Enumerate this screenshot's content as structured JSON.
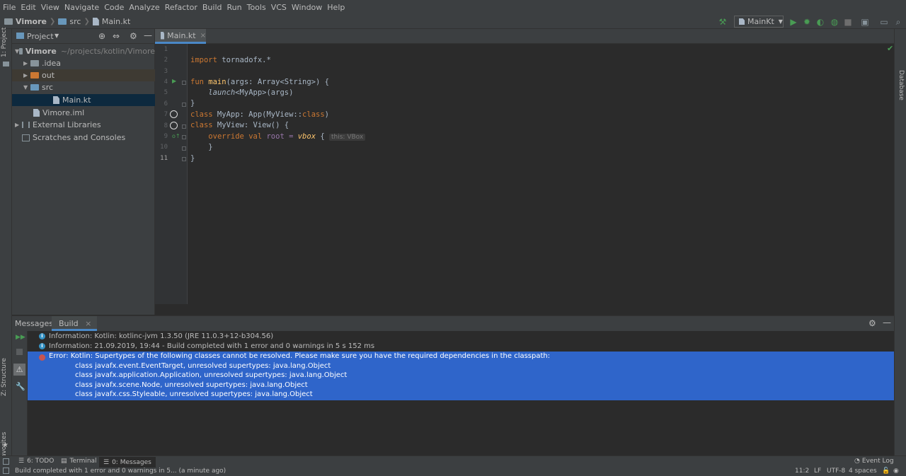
{
  "menu": [
    "File",
    "Edit",
    "View",
    "Navigate",
    "Code",
    "Analyze",
    "Refactor",
    "Build",
    "Run",
    "Tools",
    "VCS",
    "Window",
    "Help"
  ],
  "breadcrumb": {
    "project": "Vimore",
    "folder": "src",
    "file": "Main.kt"
  },
  "run_config": {
    "label": "MainKt"
  },
  "left_strip": {
    "project_tab": "1: Project",
    "structure_tab": "Z: Structure",
    "favorites_tab": "2: Favorites"
  },
  "right_strip": {
    "database_tab": "Database"
  },
  "project_panel": {
    "title": "Project",
    "tree": [
      {
        "label": "Vimore",
        "hint": "~/projects/kotlin/Vimore"
      },
      {
        "label": ".idea"
      },
      {
        "label": "out"
      },
      {
        "label": "src"
      },
      {
        "label": "Main.kt"
      },
      {
        "label": "Vimore.iml"
      },
      {
        "label": "External Libraries"
      },
      {
        "label": "Scratches and Consoles"
      }
    ]
  },
  "editor": {
    "tab_label": "Main.kt",
    "line_numbers": [
      "1",
      "2",
      "3",
      "4",
      "5",
      "6",
      "7",
      "8",
      "9",
      "10",
      "11"
    ],
    "code": {
      "l2_kw": "import",
      "l2_rest": " tornadofx.*",
      "l4_kw": "fun",
      "l4_fn": " main",
      "l4_rest": "(args: Array<String>) {",
      "l5_indent": "    ",
      "l5_fn": "launch",
      "l5_rest": "<MyApp>(args)",
      "l6": "}",
      "l7_kw": "class",
      "l7_a": " MyApp: App(MyView::",
      "l7_kw2": "class",
      "l7_b": ")",
      "l8_kw": "class",
      "l8_rest": " MyView: View() {",
      "l9_indent": "    ",
      "l9_kw": "override val",
      "l9_a": " root = ",
      "l9_fn": "vbox",
      "l9_b": " { ",
      "l9_hint": "this: VBox",
      "l10": "    }",
      "l11": "}"
    }
  },
  "messages": {
    "title": "Messages:",
    "tab": "Build",
    "info1": "Information: Kotlin: kotlinc-jvm 1.3.50 (JRE 11.0.3+12-b304.56)",
    "info2": "Information: 21.09.2019, 19:44 - Build completed with 1 error and 0 warnings in 5 s 152 ms",
    "error_title": "Error: Kotlin: Supertypes of the following classes cannot be resolved. Please make sure you have the required dependencies in the classpath:",
    "error_lines": [
      "class javafx.event.EventTarget, unresolved supertypes: java.lang.Object",
      "class javafx.application.Application, unresolved supertypes: java.lang.Object",
      "class javafx.scene.Node, unresolved supertypes: java.lang.Object",
      "class javafx.css.Styleable, unresolved supertypes: java.lang.Object"
    ]
  },
  "bottom_tabs": {
    "todo": "6: TODO",
    "terminal": "Terminal",
    "messages": "0: Messages",
    "event_log": "Event Log"
  },
  "status": {
    "message": "Build completed with 1 error and 0 warnings in 5... (a minute ago)",
    "position": "11:2",
    "line_sep": "LF",
    "encoding": "UTF-8",
    "indent": "4 spaces"
  },
  "colors": {
    "accent": "#4a88c7",
    "error_selection": "#2f65ca",
    "keyword": "#cc7832",
    "function": "#ffc66d",
    "run_green": "#499c54"
  }
}
